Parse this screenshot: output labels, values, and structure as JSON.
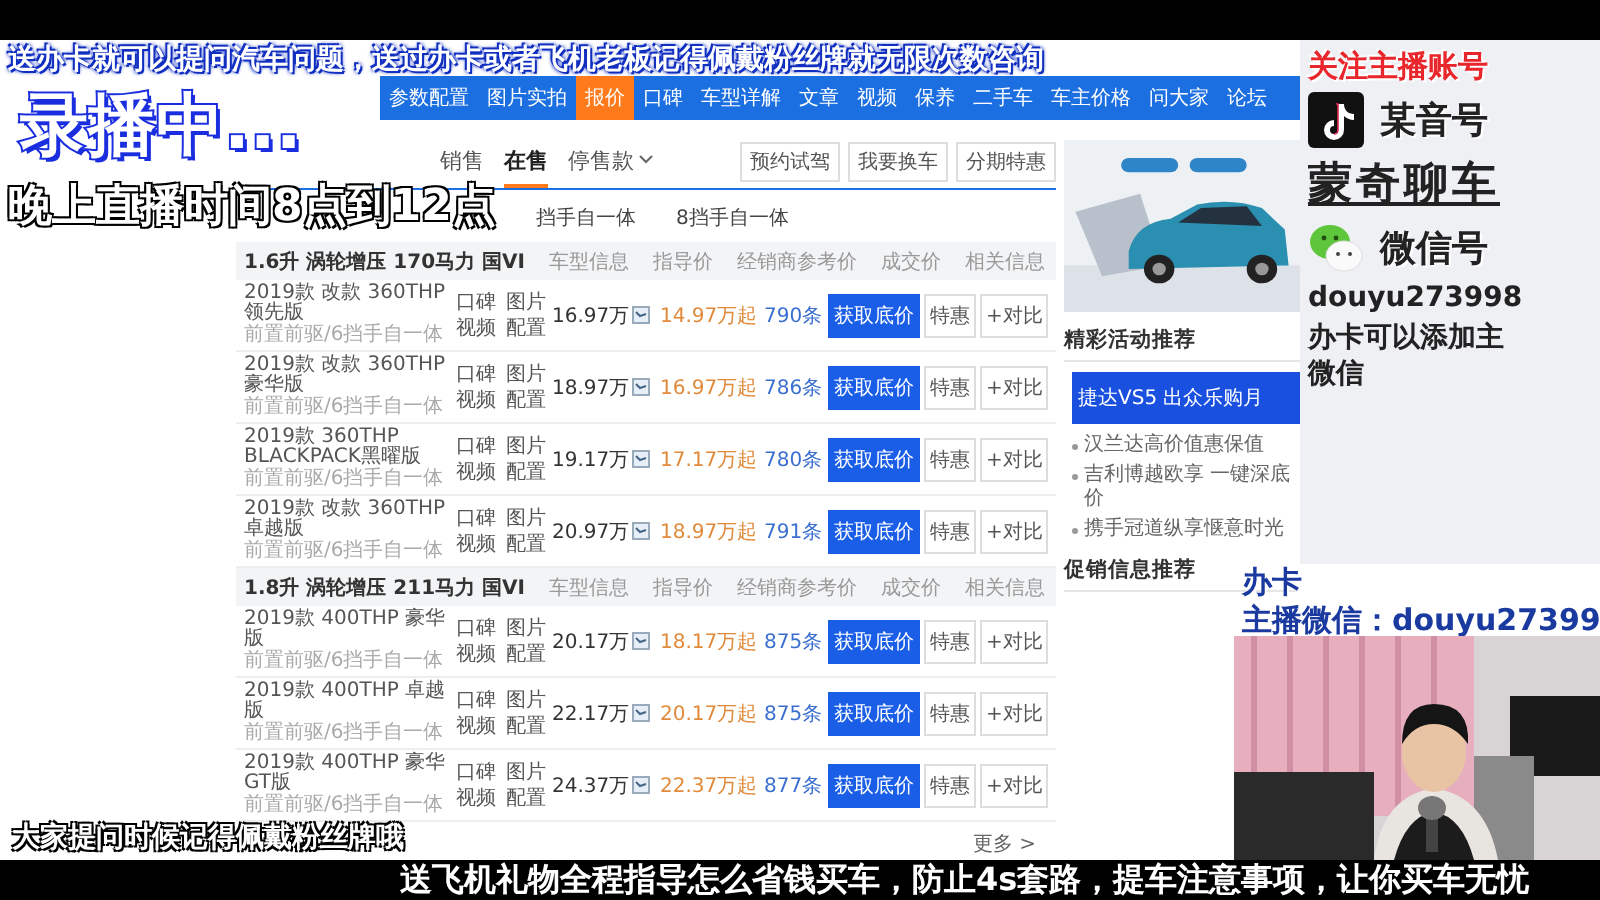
{
  "top_banner": "送办卡就可以提问汽车问题，送过办卡或者飞机老板记得佩戴粉丝牌就无限次数咨询",
  "recording_badge": "录播中...",
  "schedule_note": "晚上直播时间8点到12点",
  "nav": [
    {
      "label": "参数配置",
      "selected": false
    },
    {
      "label": "图片实拍",
      "selected": false
    },
    {
      "label": "报价",
      "selected": true
    },
    {
      "label": "口碑",
      "selected": false
    },
    {
      "label": "车型详解",
      "selected": false
    },
    {
      "label": "文章",
      "selected": false
    },
    {
      "label": "视频",
      "selected": false
    },
    {
      "label": "保养",
      "selected": false
    },
    {
      "label": "二手车",
      "selected": false
    },
    {
      "label": "车主价格",
      "selected": false
    },
    {
      "label": "问大家",
      "selected": false
    },
    {
      "label": "论坛",
      "selected": false
    }
  ],
  "tabs": [
    {
      "label": "销售",
      "selected": false,
      "has_menu": false
    },
    {
      "label": "在售",
      "selected": true,
      "has_menu": false
    },
    {
      "label": "停售款",
      "selected": false,
      "has_menu": true
    }
  ],
  "actions": [
    "预约试驾",
    "我要换车",
    "分期特惠"
  ],
  "filters": [
    "挡手自一体",
    "8挡手自一体"
  ],
  "groups": [
    {
      "title": "1.6升 涡轮增压 170马力 国VI",
      "columns": [
        "车型信息",
        "指导价",
        "经销商参考价",
        "成交价",
        "相关信息"
      ],
      "rows": [
        {
          "model": "2019款 改款 360THP 领先版",
          "drivetrain": "前置前驱/6挡手自一体",
          "links": [
            "口碑",
            "图片",
            "视频",
            "配置"
          ],
          "guide_price": "16.97万",
          "dealer_price": "14.97万起",
          "deals": "790条",
          "buttons": [
            "获取底价",
            "特惠",
            "+对比"
          ]
        },
        {
          "model": "2019款 改款 360THP 豪华版",
          "drivetrain": "前置前驱/6挡手自一体",
          "links": [
            "口碑",
            "图片",
            "视频",
            "配置"
          ],
          "guide_price": "18.97万",
          "dealer_price": "16.97万起",
          "deals": "786条",
          "buttons": [
            "获取底价",
            "特惠",
            "+对比"
          ]
        },
        {
          "model": "2019款 360THP BLACKPACK黑曜版",
          "drivetrain": "前置前驱/6挡手自一体",
          "links": [
            "口碑",
            "图片",
            "视频",
            "配置"
          ],
          "guide_price": "19.17万",
          "dealer_price": "17.17万起",
          "deals": "780条",
          "buttons": [
            "获取底价",
            "特惠",
            "+对比"
          ]
        },
        {
          "model": "2019款 改款 360THP 卓越版",
          "drivetrain": "前置前驱/6挡手自一体",
          "links": [
            "口碑",
            "图片",
            "视频",
            "配置"
          ],
          "guide_price": "20.97万",
          "dealer_price": "18.97万起",
          "deals": "791条",
          "buttons": [
            "获取底价",
            "特惠",
            "+对比"
          ]
        }
      ]
    },
    {
      "title": "1.8升 涡轮增压 211马力 国VI",
      "columns": [
        "车型信息",
        "指导价",
        "经销商参考价",
        "成交价",
        "相关信息"
      ],
      "rows": [
        {
          "model": "2019款 400THP 豪华版",
          "drivetrain": "前置前驱/6挡手自一体",
          "links": [
            "口碑",
            "图片",
            "视频",
            "配置"
          ],
          "guide_price": "20.17万",
          "dealer_price": "18.17万起",
          "deals": "875条",
          "buttons": [
            "获取底价",
            "特惠",
            "+对比"
          ]
        },
        {
          "model": "2019款 400THP 卓越版",
          "drivetrain": "前置前驱/6挡手自一体",
          "links": [
            "口碑",
            "图片",
            "视频",
            "配置"
          ],
          "guide_price": "22.17万",
          "dealer_price": "20.17万起",
          "deals": "875条",
          "buttons": [
            "获取底价",
            "特惠",
            "+对比"
          ]
        },
        {
          "model": "2019款 400THP 豪华GT版",
          "drivetrain": "前置前驱/6挡手自一体",
          "links": [
            "口碑",
            "图片",
            "视频",
            "配置"
          ],
          "guide_price": "24.37万",
          "dealer_price": "22.37万起",
          "deals": "877条",
          "buttons": [
            "获取底价",
            "特惠",
            "+对比"
          ]
        }
      ]
    }
  ],
  "more_link": "更多 >",
  "sidebar": {
    "promo": {
      "kind": "picture"
    },
    "activities_title": "精彩活动推荐",
    "activity_banner": "捷达VS5 出众乐购月",
    "activities": [
      "汉兰达高价值惠保值",
      "吉利博越欧享 一键深底价",
      "携手冠道纵享惬意时光"
    ],
    "promotions_title": "促销信息推荐"
  },
  "streamer_panel": {
    "follow_title": "关注主播账号",
    "items": [
      {
        "kind": "tiktok",
        "label": "某音号"
      },
      {
        "kind": "name",
        "label": "蒙奇聊车"
      },
      {
        "kind": "wechat",
        "label": "微信号"
      },
      {
        "kind": "id",
        "label": "douyu273998"
      },
      {
        "kind": "note",
        "label": "办卡可以添加主微信"
      }
    ]
  },
  "partial_notice": [
    "办卡",
    "主播微信：douyu27399"
  ],
  "webcam": {
    "kind": "picture"
  },
  "fan_reminder": "大家提问时候记得佩戴粉丝牌哦",
  "bottom_ticker": "送飞机礼物全程指导怎么省钱买车，防止4s套路，提车注意事项，让你买车无忧"
}
